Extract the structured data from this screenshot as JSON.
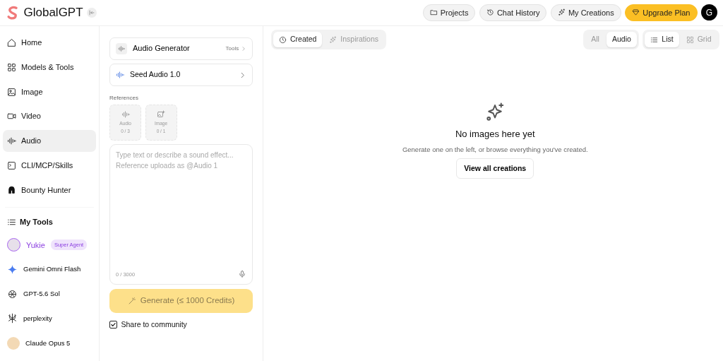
{
  "header": {
    "logo_text": "GlobalGPT",
    "buttons": [
      {
        "label": "Projects",
        "kind": "folder"
      },
      {
        "label": "Chat History",
        "kind": "history"
      },
      {
        "label": "My Creations",
        "kind": "sparkles"
      },
      {
        "label": "Upgrade Plan",
        "kind": "upgrade"
      }
    ],
    "avatar_letter": "G"
  },
  "sidebar": {
    "items": [
      {
        "label": "Home",
        "kind": "home",
        "selected": false
      },
      {
        "label": "Models & Tools",
        "kind": "grid",
        "selected": false
      },
      {
        "label": "Image",
        "kind": "image",
        "selected": false
      },
      {
        "label": "Video",
        "kind": "video",
        "selected": false
      },
      {
        "label": "Audio",
        "kind": "wave",
        "selected": true
      },
      {
        "label": "CLI/MCP/Skills",
        "kind": "terminal",
        "selected": false
      },
      {
        "label": "Bounty Hunter",
        "kind": "helmet",
        "selected": false
      }
    ],
    "my_tools": {
      "title": "My Tools",
      "items": [
        {
          "name": "Yukie",
          "badge": "Super Agent",
          "kind": "agent"
        },
        {
          "name": "Gemini Omni Flash",
          "kind": "gemini"
        },
        {
          "name": "GPT-5.6 Sol",
          "kind": "gpt"
        },
        {
          "name": "perplexity",
          "kind": "perplexity"
        },
        {
          "name": "Claude Opus 5",
          "kind": "claude"
        }
      ]
    }
  },
  "generator": {
    "tool": {
      "title": "Audio Generator",
      "link": "Tools"
    },
    "model": {
      "name": "Seed Audio 1.0"
    },
    "references": {
      "label": "References",
      "slots": [
        {
          "label": "Audio",
          "count": "0 / 3",
          "kind": "audio"
        },
        {
          "label": "Image",
          "count": "0 / 1",
          "kind": "image"
        }
      ]
    },
    "prompt": {
      "placeholder": "Type text or describe a sound effect...\nReference uploads as @Audio 1",
      "counter": "0 / 3000"
    },
    "generate": {
      "label": "Generate (≤ 1000 Credits)",
      "disabled": true
    },
    "share": {
      "label": "Share to community",
      "checked": true
    }
  },
  "creations": {
    "tabs": [
      {
        "label": "Created",
        "kind": "clock",
        "selected": true
      },
      {
        "label": "Inspirations",
        "kind": "sparkles",
        "selected": false
      }
    ],
    "filters": [
      {
        "label": "All",
        "selected": false
      },
      {
        "label": "Audio",
        "selected": true
      }
    ],
    "views": [
      {
        "label": "List",
        "kind": "list",
        "selected": true
      },
      {
        "label": "Grid",
        "kind": "grid",
        "selected": false
      }
    ],
    "empty": {
      "title": "No images here yet",
      "text": "Generate one on the left, or browse everything you've created.",
      "button": "View all creations"
    }
  }
}
